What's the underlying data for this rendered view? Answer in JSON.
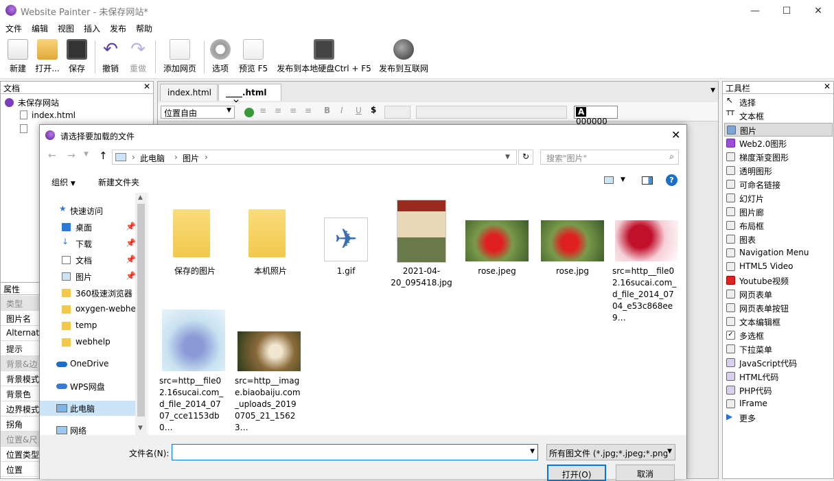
{
  "app": {
    "title": "Website Painter - 未保存网站*",
    "window_controls": [
      "minimize",
      "maximize",
      "close"
    ]
  },
  "menu": [
    "文件",
    "编辑",
    "视图",
    "插入",
    "发布",
    "帮助"
  ],
  "toolbar": [
    {
      "label": "新建",
      "icon": "new-page-icon"
    },
    {
      "label": "打开...",
      "icon": "open-folder-icon"
    },
    {
      "label": "保存",
      "icon": "save-icon"
    },
    {
      "label": "撤销",
      "icon": "undo-icon"
    },
    {
      "label": "重做",
      "icon": "redo-icon"
    },
    {
      "label": "添加网页",
      "icon": "add-page-icon"
    },
    {
      "label": "选项",
      "icon": "gear-icon"
    },
    {
      "label": "预览 F5",
      "icon": "preview-icon"
    },
    {
      "label": "发布到本地硬盘Ctrl + F5",
      "icon": "publish-disk-icon"
    },
    {
      "label": "发布到互联网",
      "icon": "publish-web-icon"
    }
  ],
  "document_panel": {
    "title": "文档",
    "tree": [
      "未保存网站",
      "index.html"
    ]
  },
  "properties_panel": {
    "title": "属性",
    "rows": [
      "类型",
      "图片名",
      "Alternate",
      "提示",
      "背景&边",
      "背景模式",
      "背景色",
      "边界模式",
      "拐角",
      "位置&尺",
      "位置类型",
      "位置"
    ]
  },
  "editor": {
    "tabs": [
      "index.html",
      "____.html"
    ],
    "position_select": "位置自由",
    "color_value": "000000",
    "color_letter": "A"
  },
  "tools_panel": {
    "title": "工具栏",
    "items": [
      "选择",
      "文本框",
      "图片",
      "Web2.0图形",
      "梯度渐变图形",
      "透明图形",
      "可命名链接",
      "幻灯片",
      "图片廊",
      "布局框",
      "图表",
      "Navigation Menu",
      "HTML5 Video",
      "Youtube视频",
      "网页表单",
      "网页表单按钮",
      "文本编辑框",
      "多选框",
      "下拉菜单",
      "JavaScript代码",
      "HTML代码",
      "PHP代码",
      "IFrame",
      "更多"
    ]
  },
  "dialog": {
    "title": "请选择要加载的文件",
    "breadcrumb": [
      "此电脑",
      "图片"
    ],
    "search_placeholder": "搜索\"图片\"",
    "organize": "组织",
    "new_folder": "新建文件夹",
    "nav": {
      "quick_access": "快速访问",
      "pinned": [
        "桌面",
        "下载",
        "文档",
        "图片"
      ],
      "recent": [
        "360极速浏览器",
        "oxygen-webhe",
        "temp",
        "webhelp"
      ],
      "onedrive": "OneDrive",
      "wps": "WPS网盘",
      "this_pc": "此电脑",
      "network": "网络"
    },
    "files": [
      {
        "name": "保存的图片",
        "kind": "folder"
      },
      {
        "name": "本机照片",
        "kind": "folder"
      },
      {
        "name": "1.gif",
        "kind": "gif"
      },
      {
        "name": "2021-04-20_095418.jpg",
        "kind": "poster"
      },
      {
        "name": "rose.jpeg",
        "kind": "rose"
      },
      {
        "name": "rose.jpg",
        "kind": "rose"
      },
      {
        "name": "src=http__file02.16sucai.com_d_file_2014_0704_e53c868ee9…",
        "kind": "rose2"
      },
      {
        "name": "src=http__file02.16sucai.com_d_file_2014_0707_cce1153db0…",
        "kind": "flower"
      },
      {
        "name": "src=http__image.biaobaiju.com_uploads_20190705_21_15623…",
        "kind": "hand"
      }
    ],
    "filename_label": "文件名(N):",
    "filename_value": "",
    "filter": "所有图文件 (*.jpg;*.jpeg;*.png",
    "open_button": "打开(O)",
    "cancel_button": "取消"
  }
}
